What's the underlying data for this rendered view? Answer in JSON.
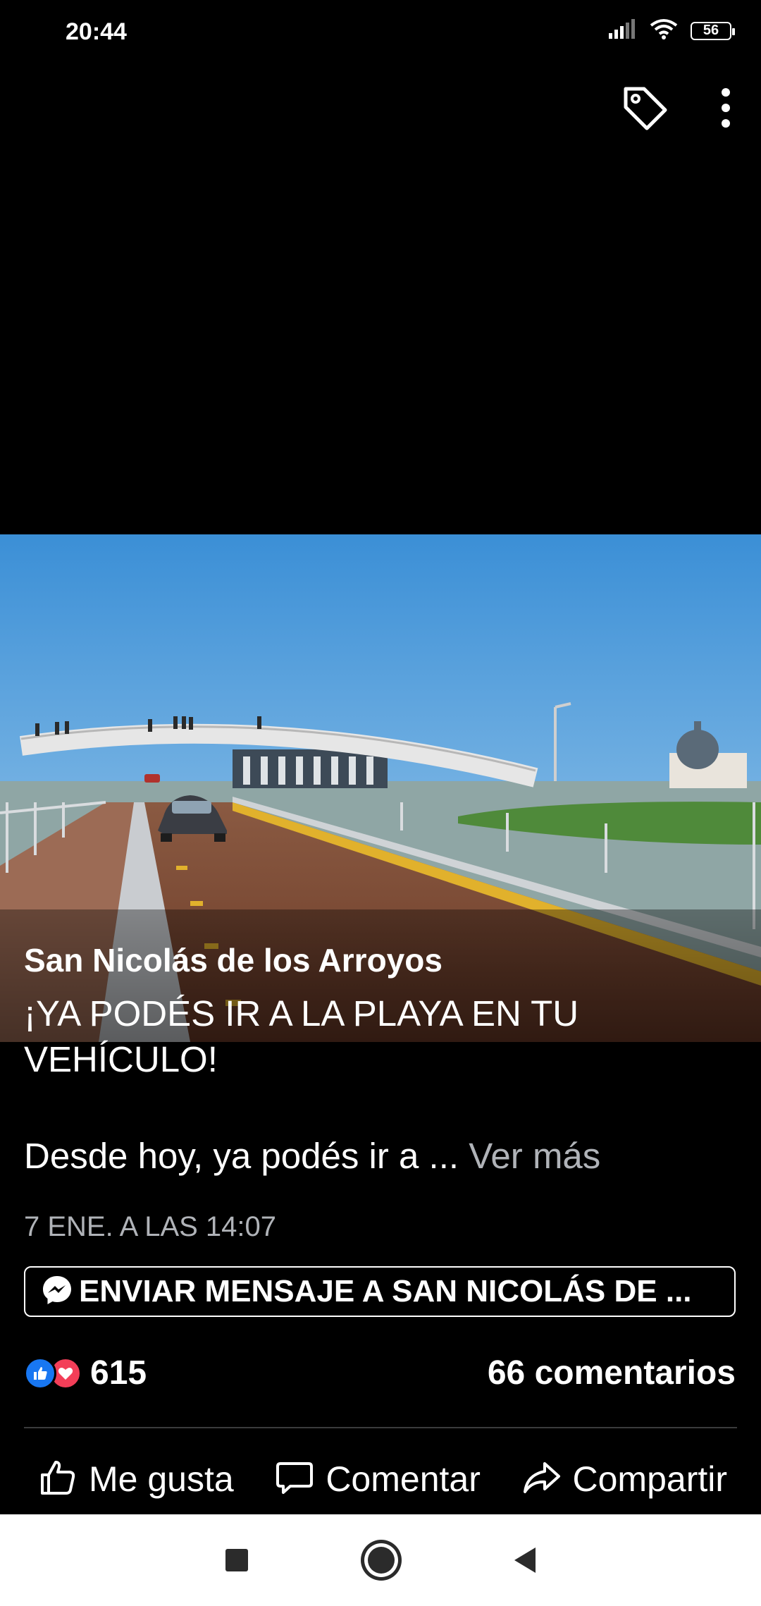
{
  "status_bar": {
    "time": "20:44",
    "battery": "56",
    "icons": [
      "signal-icon",
      "wifi-icon",
      "battery-icon"
    ]
  },
  "top_actions": {
    "icons": [
      "tag-icon",
      "more-vertical-icon"
    ]
  },
  "post": {
    "page_name": "San Nicolás de los Arroyos",
    "headline": "¡YA PODÉS IR A LA PLAYA EN TU\nVEHÍCULO!",
    "preview": "Desde hoy, ya podés ir a ...",
    "see_more": "Ver más",
    "timestamp": "7 ENE. A LAS 14:07",
    "message_button": "ENVIAR MENSAJE A SAN NICOLÁS DE ...",
    "reaction_count": "615",
    "comments": "66 comentarios"
  },
  "actions": {
    "like": "Me gusta",
    "comment": "Comentar",
    "share": "Compartir"
  },
  "colors": {
    "background": "#000000",
    "like_blue": "#1877f2",
    "love_red": "#f33e58",
    "secondary_text": "#b0b3b8"
  }
}
